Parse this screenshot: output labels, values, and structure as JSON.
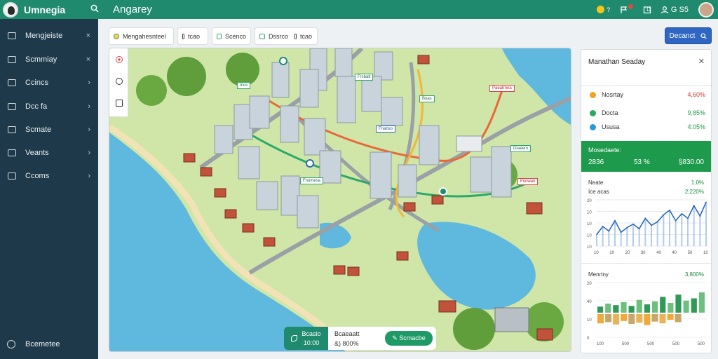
{
  "topbar": {
    "app_title": "Umnegia",
    "page_title": "Angarey",
    "search_icon": "search-icon",
    "items": [
      {
        "icon": "coin-icon",
        "label": "?"
      },
      {
        "icon": "flag-icon",
        "label": ""
      },
      {
        "icon": "calendar-icon",
        "label": "D"
      },
      {
        "icon": "user-icon",
        "label": "G S5"
      }
    ]
  },
  "sidebar": {
    "items": [
      {
        "label": "Mengjeiste",
        "icon": "grid-icon",
        "chevron": "×"
      },
      {
        "label": "Scmmiay",
        "icon": "home-icon",
        "chevron": "×"
      },
      {
        "label": "Ccincs",
        "icon": "file-icon",
        "chevron": "›"
      },
      {
        "label": "Dcc fa",
        "icon": "folder-icon",
        "chevron": "›"
      },
      {
        "label": "Scmate",
        "icon": "briefcase-icon",
        "chevron": "›"
      },
      {
        "label": "Veants",
        "icon": "share-icon",
        "chevron": "›"
      },
      {
        "label": "Ccoms",
        "icon": "chart-icon",
        "chevron": "›"
      }
    ],
    "footer": "Bcemetee"
  },
  "filters": [
    {
      "label": "Mengahesnteel"
    },
    {
      "label": "tcao"
    },
    {
      "label": "Scenco"
    },
    {
      "label": "Dssrco"
    },
    {
      "label": "tcao"
    }
  ],
  "primary_button": {
    "label": "Decanct",
    "icon": "search-icon"
  },
  "map": {
    "tools": [
      "pin-icon",
      "compass-icon",
      "layers-icon"
    ],
    "labels": [
      "tnos",
      "Frsbalt",
      "Buas",
      "Paeatrnna",
      "Fnanso",
      "Dtaeem",
      "Fnomesa",
      "Fnowan"
    ]
  },
  "bottom_bar": {
    "stat1_label": "Bcasio",
    "stat1_value": "10:00",
    "stat2_label": "Bcaeaatt",
    "stat2_value": "&) 800%",
    "button_label": "Scmacbe"
  },
  "panel": {
    "title": "Manathan Seaday",
    "rows": [
      {
        "label": "Nosrtay",
        "value": "4,60%",
        "color": "#e8a623"
      },
      {
        "label": "Docta",
        "value": "9,85%",
        "color": "#2ea860",
        "positive": true
      },
      {
        "label": "Ususa",
        "value": "4:05%",
        "color": "#2a9ad5",
        "positive": true
      }
    ],
    "green_box": {
      "label": "Mosedaete:",
      "v1": "2836",
      "v2": "53 %",
      "v3": "§830.00"
    },
    "chart1": {
      "title": "Neate",
      "sub": "Ice acas",
      "v1": "1.0%",
      "v2": "2,220%"
    },
    "chart2": {
      "title": "Menrtny",
      "v1": "3,800%"
    }
  },
  "chart_data": [
    {
      "type": "area",
      "title": "",
      "ylim": [
        0,
        40
      ],
      "x_ticks": [
        "10",
        "10",
        "20",
        "30",
        "40",
        "40",
        "50",
        "10"
      ],
      "y_ticks": [
        "20",
        "10",
        "10",
        "10",
        "10"
      ],
      "values": [
        10,
        17,
        13,
        22,
        12,
        16,
        19,
        15,
        24,
        18,
        21,
        27,
        31,
        22,
        28,
        24,
        35,
        26,
        38
      ]
    },
    {
      "type": "bar",
      "title": "",
      "ylim": [
        0,
        40
      ],
      "x_ticks": [
        "100",
        "500",
        "500",
        "500",
        "500"
      ],
      "y_ticks": [
        "20",
        "40",
        "10",
        "0"
      ],
      "series": [
        {
          "color": "#2f9a58",
          "values": [
            8,
            12,
            10,
            14,
            9,
            17,
            11,
            15,
            21,
            13,
            24,
            16,
            19,
            27
          ]
        },
        {
          "color": "#f2a93b",
          "values": [
            16,
            14,
            18,
            12,
            17,
            15,
            19,
            13,
            16,
            10,
            14
          ]
        }
      ]
    }
  ]
}
